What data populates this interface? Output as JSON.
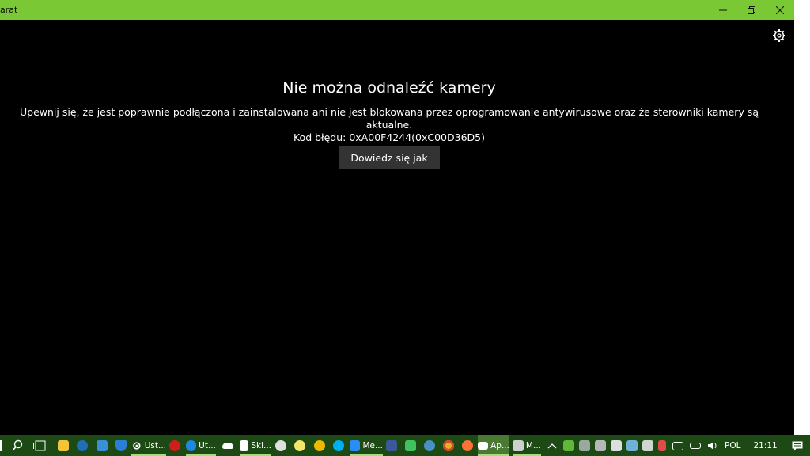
{
  "window": {
    "title": "arat",
    "heading": "Nie można odnaleźć kamery",
    "message": "Upewnij się, że jest poprawnie podłączona i zainstalowana ani nie jest blokowana przez oprogramowanie antywirusowe oraz że sterowniki kamery są aktualne.",
    "error_code": "Kod błędu: 0xA00F4244(0xC00D36D5)",
    "button_label": "Dowiedz się jak"
  },
  "taskbar": {
    "items": [
      {
        "label": "Ust..."
      },
      {
        "label": "Ut..."
      },
      {
        "label": "Skl..."
      },
      {
        "label": "Me..."
      },
      {
        "label": "Ap..."
      },
      {
        "label": "M..."
      }
    ],
    "language": "POL",
    "time": "21:11"
  },
  "colors": {
    "titlebar": "#7ac934",
    "window_bg": "#000000",
    "button_bg": "#333333",
    "taskbar_bg": "#1d4a14"
  }
}
